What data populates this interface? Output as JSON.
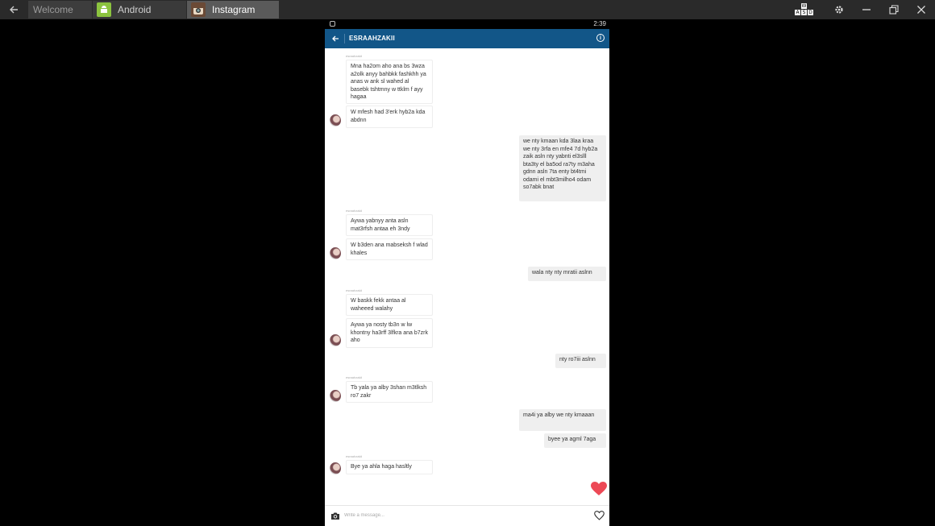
{
  "window": {
    "tabs": [
      {
        "label": "Welcome",
        "active": false
      },
      {
        "label": "Android",
        "active": false
      },
      {
        "label": "Instagram",
        "active": true
      }
    ],
    "controls": [
      "keymap-icon",
      "settings-icon",
      "minimize-icon",
      "restore-icon",
      "close-icon"
    ]
  },
  "status_bar": {
    "time": "2:39"
  },
  "app_bar": {
    "title": "ESRAAHZAKII"
  },
  "thread": {
    "sender_label": "esraahzakii",
    "messages": [
      {
        "dir": "in",
        "text": "Mna ha2om aho ana bs 3wza a2olk anyy bahbkk fashkhh ya anas w ank sl wahed al basebk tshtmny w ttklm f ayy hagaa"
      },
      {
        "dir": "in",
        "text": "W mfesh had 3'erk hyb2a kda abdnn"
      },
      {
        "dir": "out",
        "text": "we nty kmaan kda 3laa kraa we nty 3rfa en mfe4 7d hyb2a zaik asln nty yabnti el3slll bta3ty  el ba5od ra7ty m3aha gdnn asln 7ta enty bt4tmi odami el mbt3milho4 odam so7abk bnat"
      },
      {
        "dir": "in",
        "text": "Aywa yabnyy anta asln mat3rfsh antaa eh 3ndy"
      },
      {
        "dir": "in",
        "text": "W b3den ana mabseksh f wlad khales"
      },
      {
        "dir": "out",
        "text": "wala nty nty mratii aslnn"
      },
      {
        "dir": "in",
        "text": "W baskk fekk antaa al waheeed walahy"
      },
      {
        "dir": "in",
        "text": "Aywa ya nosty tb3n w lw khontny ha3rff 3lfkra ana b7zrk aho"
      },
      {
        "dir": "out",
        "text": "nty ro7iii aslnn"
      },
      {
        "dir": "in",
        "text": "Tb yala ya alby 3shan m3tlksh ro7 zakr"
      },
      {
        "dir": "out",
        "text": "ma4i ya alby we nty kmaaan"
      },
      {
        "dir": "out",
        "text": "byee ya agml 7aga"
      },
      {
        "dir": "in",
        "text": "Bye ya ahla haga hasltly"
      }
    ],
    "liked": true
  },
  "composer": {
    "placeholder": "Write a message..."
  },
  "colors": {
    "appbar": "#125688",
    "heart": "#ed4956"
  }
}
